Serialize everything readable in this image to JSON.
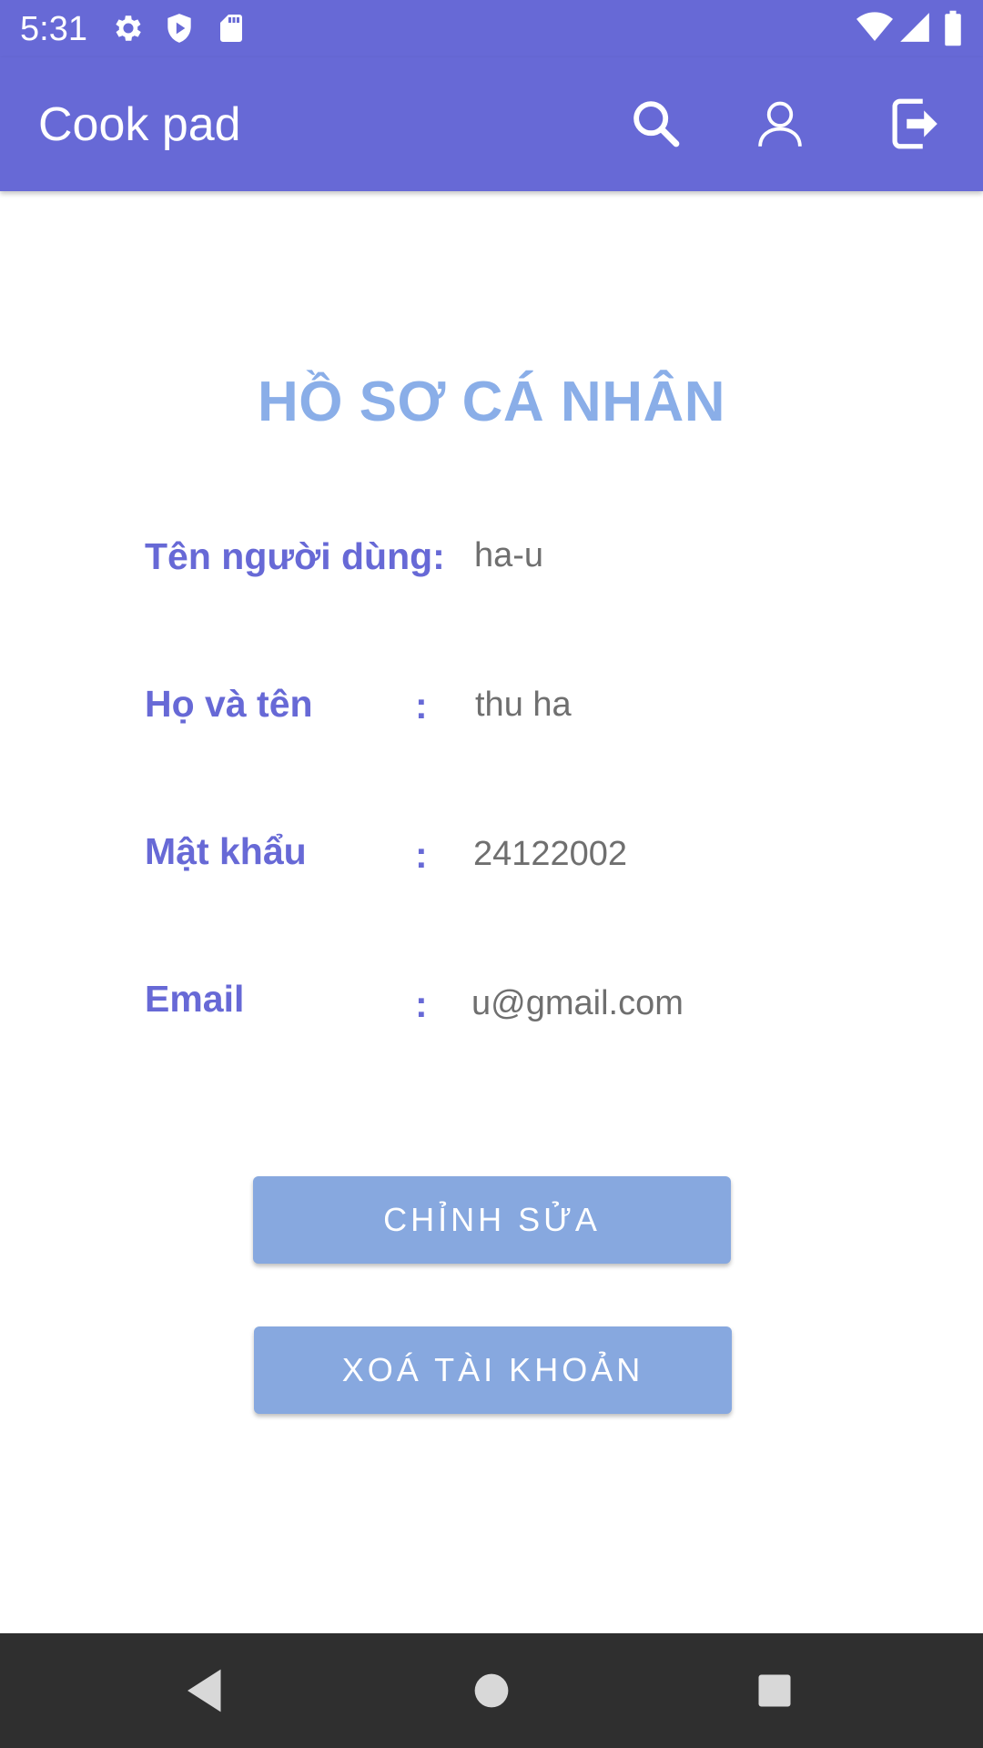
{
  "status_bar": {
    "time": "5:31",
    "left_icons": [
      "gear-icon",
      "shield-play-icon",
      "sd-card-icon"
    ],
    "right_icons": [
      "wifi-icon",
      "cellular-signal-icon",
      "battery-icon"
    ]
  },
  "app_bar": {
    "title": "Cook pad",
    "actions": [
      "search-icon",
      "account-icon",
      "logout-icon"
    ],
    "background": "#6769d6"
  },
  "profile": {
    "title": "HỒ SƠ CÁ NHÂN",
    "fields": [
      {
        "label": "Tên người dùng:",
        "colon": "",
        "value": "ha-u"
      },
      {
        "label": "Họ và tên",
        "colon": ":",
        "value": "thu ha"
      },
      {
        "label": "Mật khẩu",
        "colon": ":",
        "value": "24122002"
      },
      {
        "label": "Email",
        "colon": ":",
        "value": "u@gmail.com"
      }
    ]
  },
  "buttons": {
    "edit": "CHỈNH SỬA",
    "delete": "XOÁ TÀI KHOẢN"
  },
  "colors": {
    "accent": "#6769d6",
    "title": "#8aaee8",
    "button": "#87a8df",
    "value_text": "#6f6f6f"
  },
  "nav_bar": {
    "buttons": [
      "back-icon",
      "home-icon",
      "recents-icon"
    ]
  }
}
